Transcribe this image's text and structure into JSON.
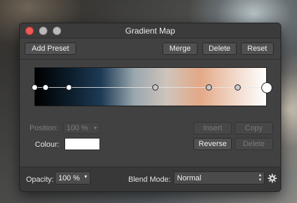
{
  "window": {
    "title": "Gradient Map"
  },
  "toolbar": {
    "add_preset": "Add Preset",
    "merge": "Merge",
    "delete": "Delete",
    "reset": "Reset"
  },
  "gradient": {
    "colors": [
      "#000000",
      "#0b1b28",
      "#1c3b55",
      "#9aa7ae",
      "#cfc4bb",
      "#e3a887",
      "#f0d6c6",
      "#ffffff"
    ],
    "stops": [
      {
        "position": 0.0,
        "selected": false
      },
      {
        "position": 0.05,
        "selected": false
      },
      {
        "position": 0.15,
        "selected": false
      },
      {
        "position": 0.52,
        "selected": false
      },
      {
        "position": 0.75,
        "selected": false
      },
      {
        "position": 0.875,
        "selected": false
      },
      {
        "position": 1.0,
        "selected": true
      }
    ]
  },
  "stop_editor": {
    "position_label": "Position:",
    "position_value": "100 %",
    "colour_label": "Colour:",
    "colour_value": "#ffffff",
    "insert": "Insert",
    "copy": "Copy",
    "reverse": "Reverse",
    "delete": "Delete"
  },
  "footer": {
    "opacity_label": "Opacity:",
    "opacity_value": "100 %",
    "blend_mode_label": "Blend Mode:",
    "blend_mode_value": "Normal"
  }
}
